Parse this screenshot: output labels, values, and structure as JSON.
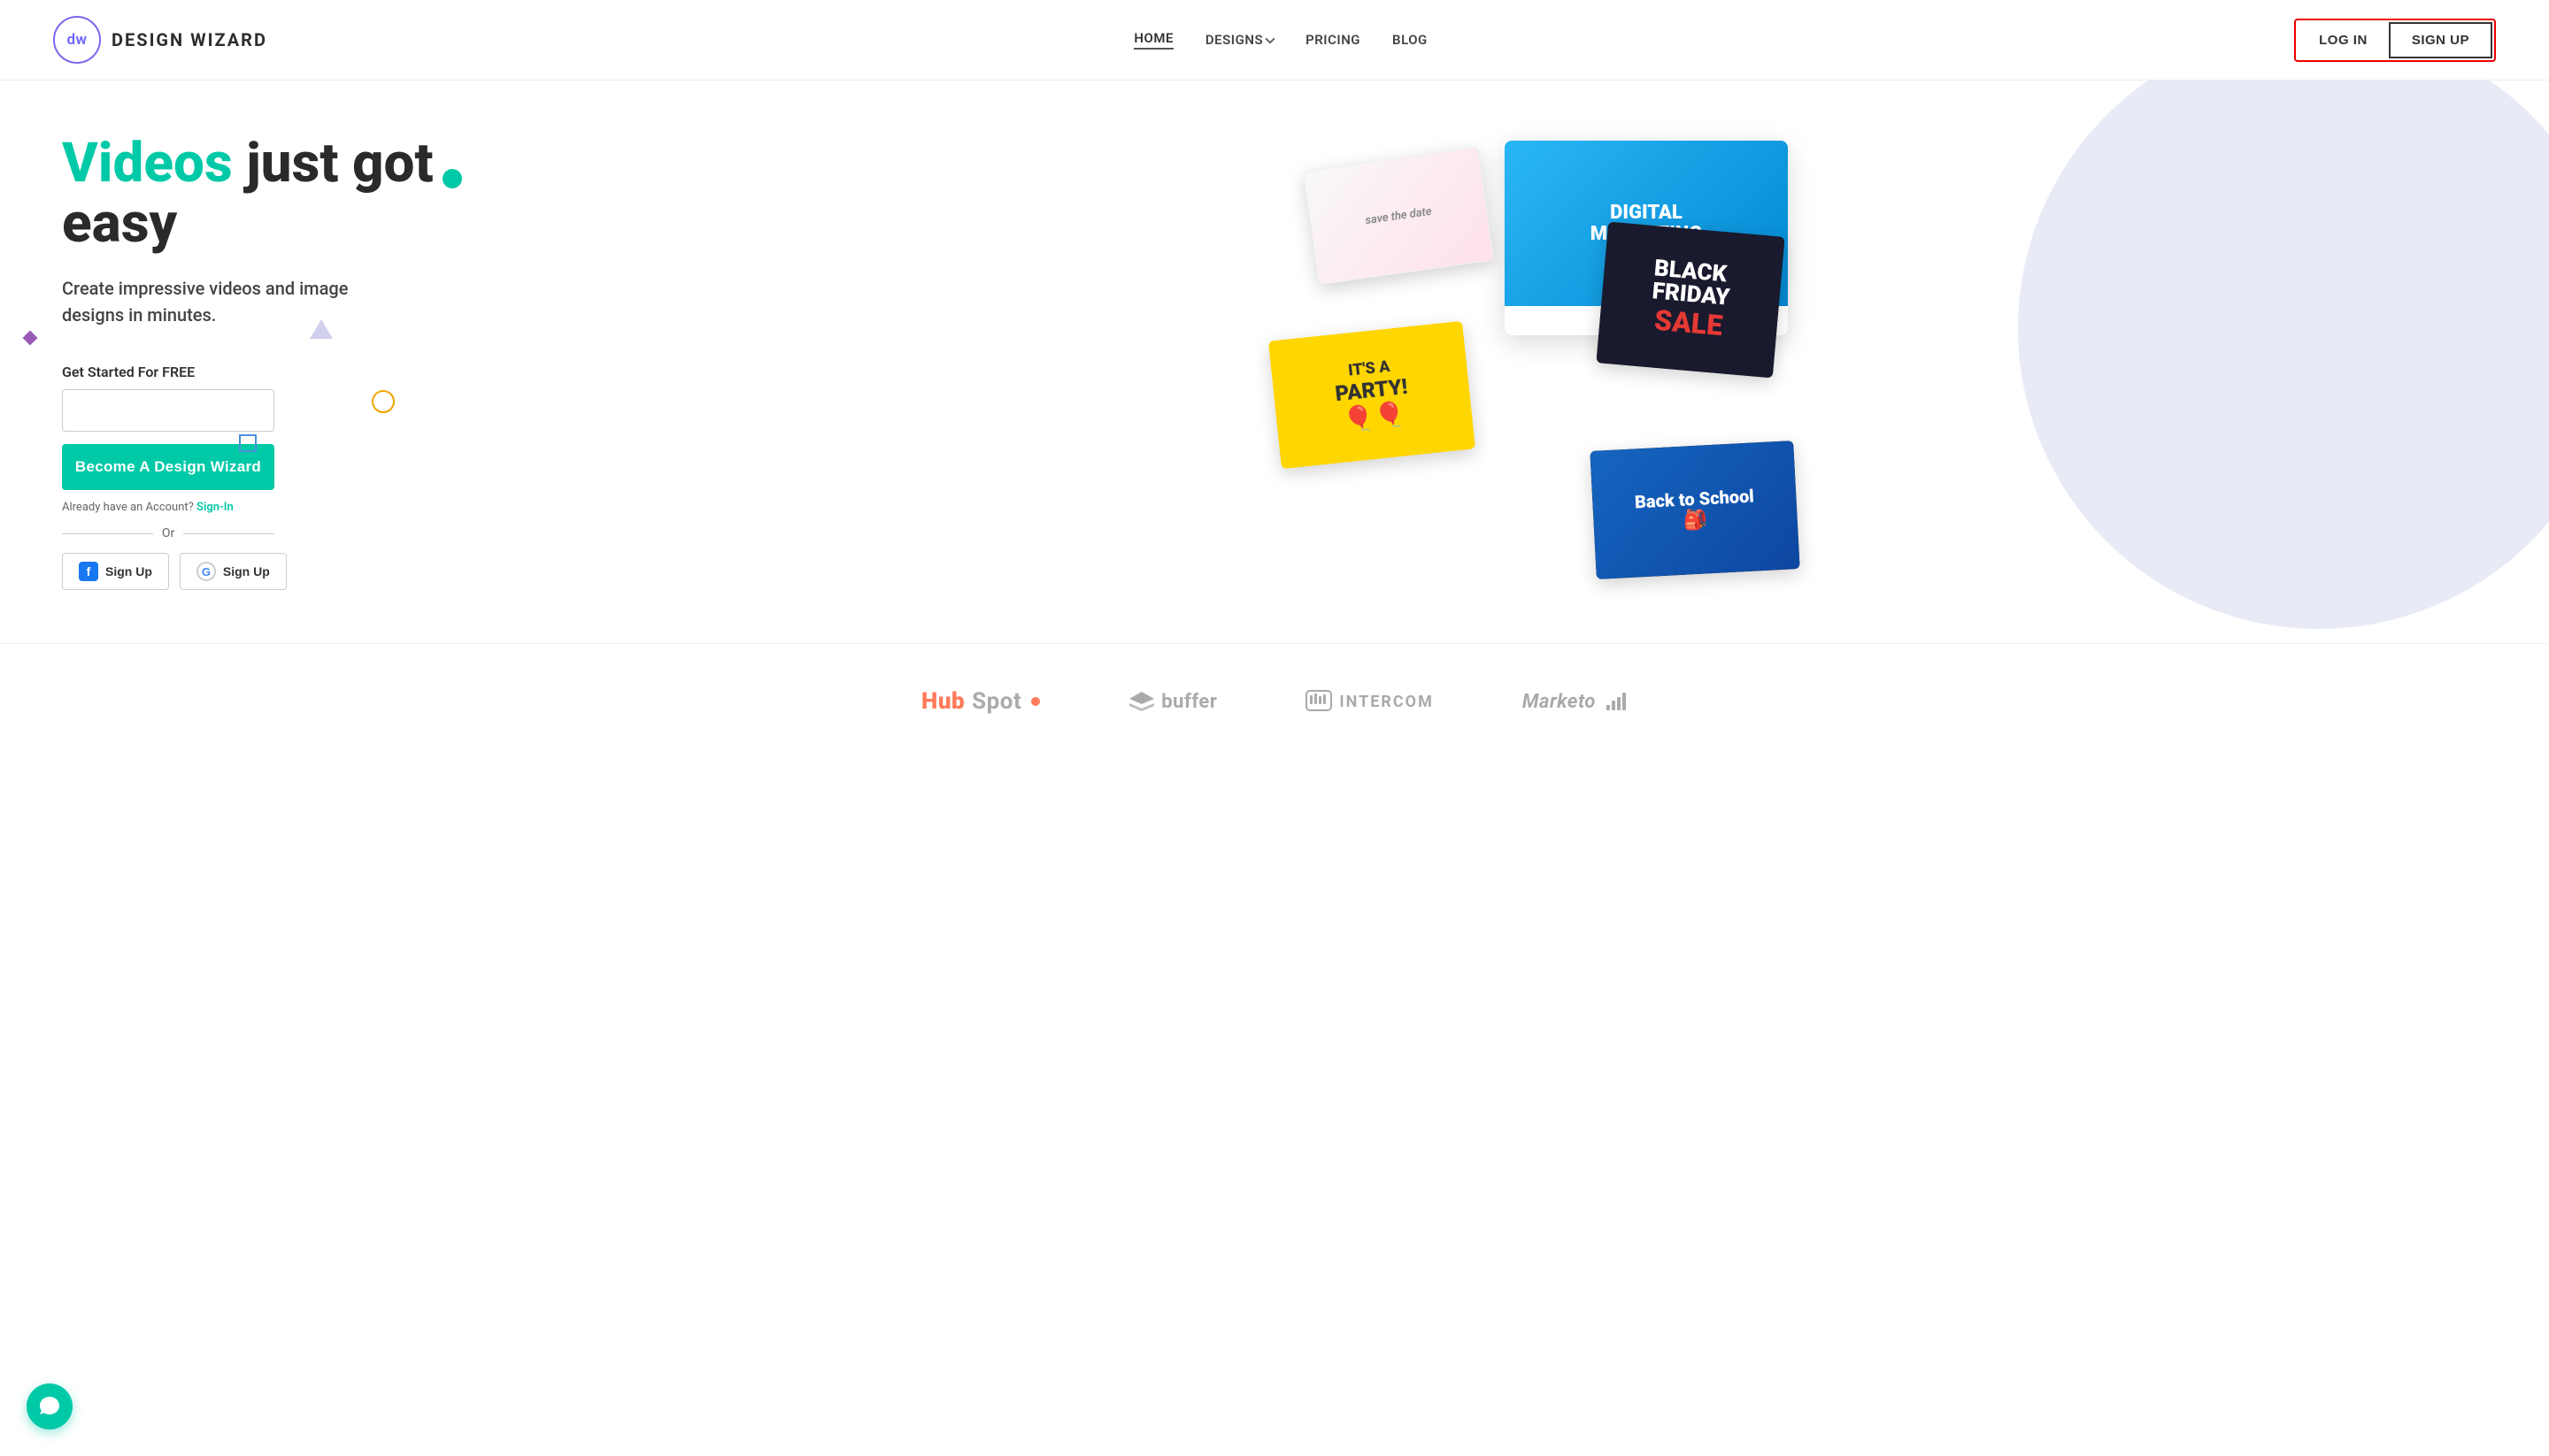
{
  "header": {
    "logo_initials": "dw",
    "logo_text": "DESIGN WIZARD",
    "nav_items": [
      {
        "label": "HOME",
        "active": true
      },
      {
        "label": "DESIGNS",
        "has_dropdown": true
      },
      {
        "label": "PRICING"
      },
      {
        "label": "BLOG"
      }
    ],
    "login_label": "LOG IN",
    "signup_label": "SIGN UP"
  },
  "hero": {
    "title_part1": "Videos",
    "title_part2": " just got easy",
    "subtitle": "Create impressive videos and image designs in minutes.",
    "get_started_label": "Get Started For FREE",
    "email_placeholder": "",
    "cta_button": "Become A Design Wizard",
    "signin_note": "Already have an Account?",
    "signin_link": "Sign-In",
    "divider_text": "Or",
    "facebook_signup": "Sign Up",
    "google_signup": "Sign Up"
  },
  "design_cards": {
    "monitor_line1": "DIGITAL",
    "monitor_line2": "MARKETING",
    "party_line1": "IT'S A",
    "party_line2": "PARTY!",
    "bf_label1": "BLACK",
    "bf_label2": "FRIDAY",
    "bf_label3": "SALE",
    "save_date_text": "save the date",
    "bts_text": "Back to School"
  },
  "partners": [
    {
      "name": "HubSpot",
      "display": "HubSpot"
    },
    {
      "name": "buffer",
      "display": "buffer"
    },
    {
      "name": "INTERCOM",
      "display": "INTERCOM"
    },
    {
      "name": "Marketo",
      "display": "Marketo"
    }
  ],
  "chat": {
    "icon": "💬"
  }
}
